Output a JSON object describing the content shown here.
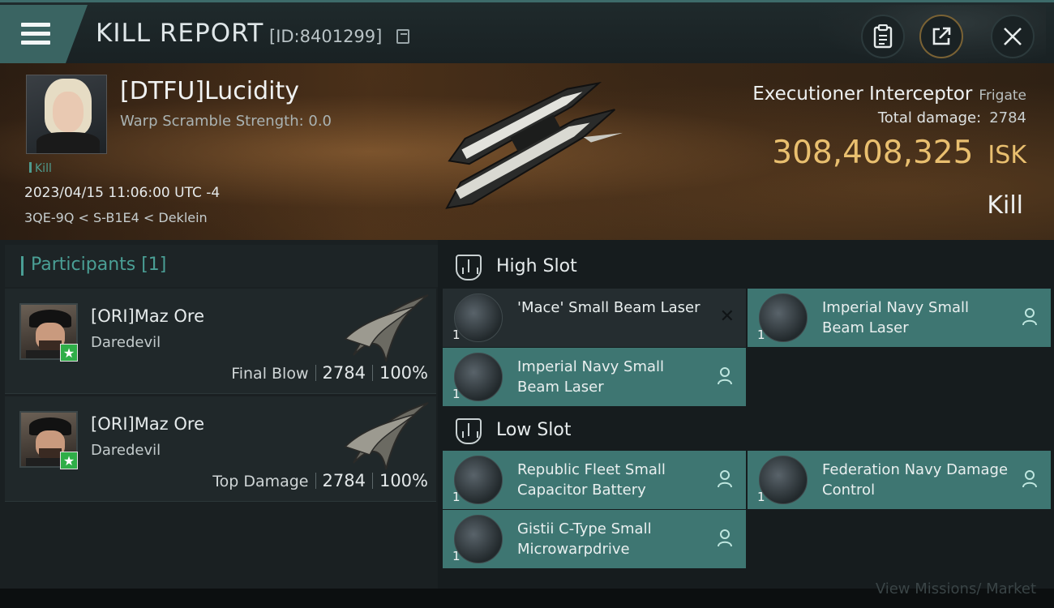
{
  "header": {
    "title": "KILL REPORT",
    "report_id": "[ID:8401299]"
  },
  "victim": {
    "name": "[DTFU]Lucidity",
    "warp_scramble": "Warp Scramble Strength: 0.0",
    "tag": "Kill",
    "datetime": "2023/04/15 11:06:00 UTC -4",
    "location": "3QE-9Q < S-B1E4 < Deklein",
    "ship_name": "Executioner Interceptor",
    "ship_class": "Frigate",
    "total_damage_label": "Total damage:",
    "total_damage": "2784",
    "isk_value": "308,408,325",
    "isk_unit": "ISK",
    "result": "Kill"
  },
  "participants": {
    "title": "Participants [1]",
    "rows": [
      {
        "name": "[ORI]Maz Ore",
        "ship": "Daredevil",
        "label": "Final Blow",
        "damage": "2784",
        "percent": "100%"
      },
      {
        "name": "[ORI]Maz Ore",
        "ship": "Daredevil",
        "label": "Top Damage",
        "damage": "2784",
        "percent": "100%"
      }
    ]
  },
  "high_slot": {
    "title": "High Slot",
    "items": [
      {
        "name": "'Mace' Small Beam Laser",
        "qty": "1",
        "state": "destroyed"
      },
      {
        "name": "Imperial Navy Small Beam Laser",
        "qty": "1",
        "state": "dropped"
      },
      {
        "name": "Imperial Navy Small Beam Laser",
        "qty": "1",
        "state": "dropped"
      }
    ]
  },
  "low_slot": {
    "title": "Low Slot",
    "items": [
      {
        "name": "Republic Fleet Small Capacitor Battery",
        "qty": "1",
        "state": "dropped"
      },
      {
        "name": "Federation Navy Damage Control",
        "qty": "1",
        "state": "dropped"
      },
      {
        "name": "Gistii C-Type Small Microwarpdrive",
        "qty": "1",
        "state": "dropped"
      }
    ]
  },
  "footer": {
    "text": "View Missions/ Market"
  },
  "colors": {
    "accent_teal": "#3e7672",
    "isk_gold": "#e9bf6f",
    "header_teal": "#3a6462"
  }
}
